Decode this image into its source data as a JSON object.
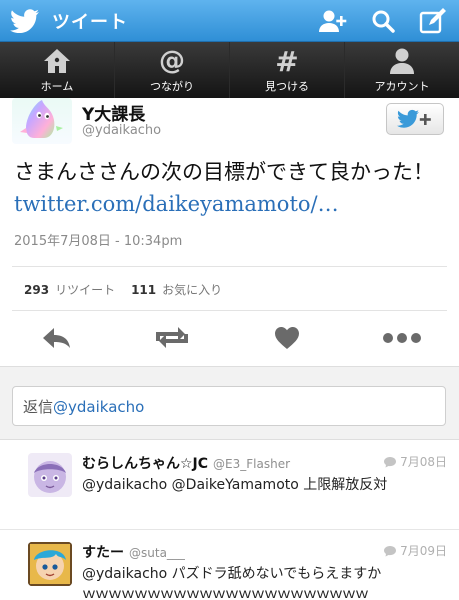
{
  "header": {
    "title": "ツイート",
    "actions": [
      "add-user-icon",
      "search-icon",
      "compose-icon"
    ]
  },
  "nav": {
    "items": [
      {
        "label": "ホーム",
        "icon": "home-icon"
      },
      {
        "label": "つながり",
        "icon": "at-icon"
      },
      {
        "label": "見つける",
        "icon": "hashtag-icon"
      },
      {
        "label": "アカウント",
        "icon": "user-icon"
      }
    ]
  },
  "tweet": {
    "display_name": "Y大課長",
    "handle": "@ydaikacho",
    "text": "さまんささんの次の目標ができて良かった！ ",
    "link": "twitter.com/daikeyamamoto/…",
    "timestamp": "2015年7月08日 - 10:34pm",
    "retweets": "293",
    "retweets_label": "リツイート",
    "favorites": "111",
    "favorites_label": "お気に入り"
  },
  "actions": [
    "reply-icon",
    "retweet-icon",
    "favorite-icon",
    "more-icon"
  ],
  "reply_box": {
    "prefix": "返信",
    "mention": "@ydaikacho"
  },
  "replies": [
    {
      "name": "むらしんちゃん☆JC",
      "handle": "@E3_Flasher",
      "date": "7月08日",
      "text": "@ydaikacho @DaikeYamamoto 上限解放反対"
    },
    {
      "name": "すたー",
      "handle": "@suta___",
      "date": "7月09日",
      "text": "@ydaikacho パズドラ舐めないでもらえますか",
      "text2": "ｗｗｗｗｗｗｗｗｗｗｗｗｗｗｗｗｗｗｗｗｗｗ"
    }
  ],
  "colors": {
    "header_blue": "#2f8fd6",
    "link_blue": "#2a6fb8",
    "nav_dark": "#1a1a1a"
  }
}
